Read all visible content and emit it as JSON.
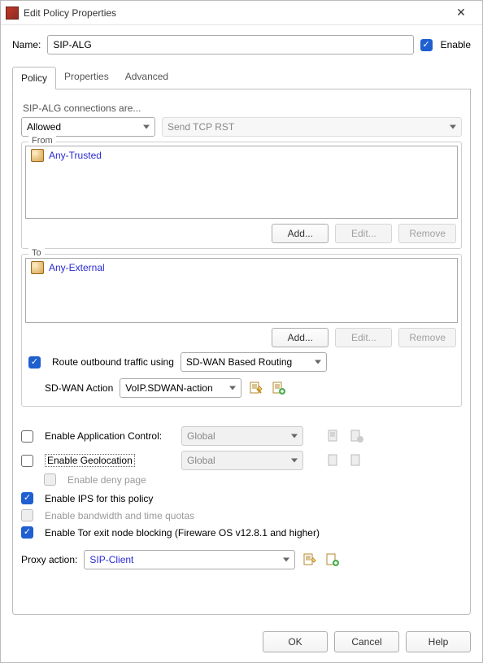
{
  "window": {
    "title": "Edit Policy Properties",
    "close_tooltip": "Close"
  },
  "name_row": {
    "label": "Name:",
    "value": "SIP-ALG",
    "enable_label": "Enable",
    "enable_checked": true
  },
  "tabs": {
    "policy": "Policy",
    "properties": "Properties",
    "advanced": "Advanced"
  },
  "policy_tab": {
    "description_prefix": "SIP-ALG connections are...",
    "disposition_value": "Allowed",
    "tcp_rst_value": "Send TCP RST",
    "from": {
      "legend": "From",
      "items": [
        "Any-Trusted"
      ],
      "add": "Add...",
      "edit": "Edit...",
      "remove": "Remove"
    },
    "to": {
      "legend": "To",
      "items": [
        "Any-External"
      ],
      "add": "Add...",
      "edit": "Edit...",
      "remove": "Remove"
    },
    "route_outbound": {
      "checked": true,
      "label": "Route outbound traffic using",
      "value": "SD-WAN Based Routing"
    },
    "sdwan_action": {
      "label": "SD-WAN Action",
      "value": "VoIP.SDWAN-action"
    },
    "app_control": {
      "checked": false,
      "label": "Enable Application Control:",
      "value": "Global"
    },
    "geolocation": {
      "checked": false,
      "label": "Enable Geolocation",
      "value": "Global",
      "deny_page_label": "Enable deny page",
      "deny_page_checked": false
    },
    "ips": {
      "checked": true,
      "label": "Enable IPS for this policy"
    },
    "quotas": {
      "checked": false,
      "label": "Enable bandwidth and time quotas"
    },
    "tor": {
      "checked": true,
      "label": "Enable Tor exit node blocking (Fireware OS v12.8.1 and higher)"
    },
    "proxy_action": {
      "label": "Proxy action:",
      "value": "SIP-Client"
    }
  },
  "footer": {
    "ok": "OK",
    "cancel": "Cancel",
    "help": "Help"
  }
}
